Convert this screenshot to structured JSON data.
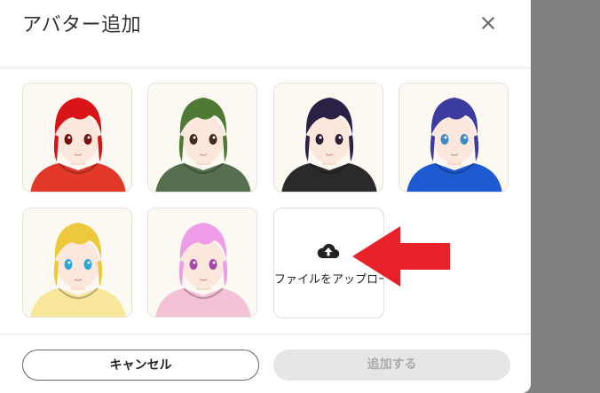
{
  "dialog": {
    "title": "アバター追加"
  },
  "avatars": [
    {
      "name": "red",
      "hair": "#d81418",
      "hoodie": "#e2382a",
      "eyes": "#7a1010"
    },
    {
      "name": "green",
      "hair": "#4e7a35",
      "hoodie": "#56704f",
      "eyes": "#3f2c1c"
    },
    {
      "name": "black",
      "hair": "#2a2145",
      "hoodie": "#2a2a2a",
      "eyes": "#281f35"
    },
    {
      "name": "blue",
      "hair": "#3c3ca0",
      "hoodie": "#1e5ad0",
      "eyes": "#3c8ac8"
    },
    {
      "name": "yellow",
      "hair": "#ecc83a",
      "hoodie": "#f8e79a",
      "eyes": "#29a7d6"
    },
    {
      "name": "pink",
      "hair": "#ef9ce8",
      "hoodie": "#f4c2d6",
      "eyes": "#a04aa6"
    }
  ],
  "upload": {
    "label": "ファイルをアップロード",
    "icon": "cloud-upload-icon"
  },
  "annotation": {
    "arrow_color": "#e82228"
  },
  "footer": {
    "cancel_label": "キャンセル",
    "add_label": "追加する"
  }
}
